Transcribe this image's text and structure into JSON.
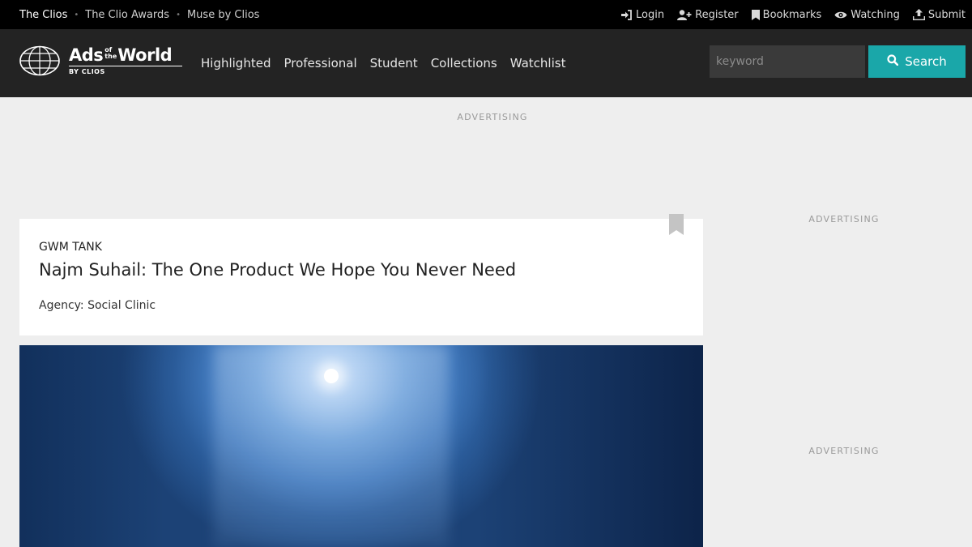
{
  "topbar": {
    "links": [
      "The Clios",
      "The Clio Awards",
      "Muse by Clios"
    ],
    "separator": "•",
    "user_links": [
      {
        "label": "Login",
        "icon": "sign-in-icon"
      },
      {
        "label": "Register",
        "icon": "user-plus-icon"
      },
      {
        "label": "Bookmarks",
        "icon": "bookmark-icon"
      },
      {
        "label": "Watching",
        "icon": "eye-icon"
      },
      {
        "label": "Submit",
        "icon": "upload-icon"
      }
    ]
  },
  "header": {
    "logo": {
      "ads": "Ads",
      "of": "of",
      "the": "the",
      "world": "World",
      "by": "BY CLIOS"
    },
    "nav": [
      "Highlighted",
      "Professional",
      "Student",
      "Collections",
      "Watchlist"
    ],
    "search": {
      "placeholder": "keyword",
      "value": "",
      "button_label": "Search"
    }
  },
  "ads": {
    "label": "ADVERTISING"
  },
  "article": {
    "brand": "GWM TANK",
    "title": "Najm Suhail: The One Product We Hope You Never Need",
    "agency": "Agency: Social Clinic"
  },
  "colors": {
    "topbar_bg": "#000000",
    "header_bg": "#232323",
    "accent": "#1aa7a9",
    "page_bg": "#eeeeee"
  }
}
